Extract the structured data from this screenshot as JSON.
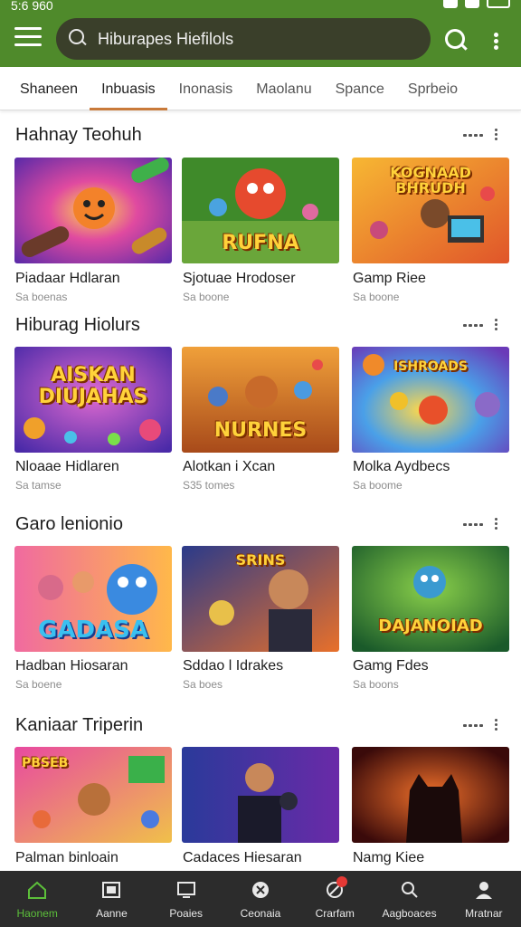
{
  "status": {
    "time": "5:6 960"
  },
  "search": {
    "placeholder": "Hiburapes Hiefilols"
  },
  "tabs": [
    "Shaneen",
    "Inbuasis",
    "Inonasis",
    "Maolanu",
    "Spance",
    "Sprbeio"
  ],
  "sections": [
    {
      "title": "Hahnay Teohuh",
      "cards": [
        {
          "title": "Piadaar Hdlaran",
          "sub": "Sa boenas",
          "thumb_text": ""
        },
        {
          "title": "Sjotuae Hrodoser",
          "sub": "Sa boone",
          "thumb_text": "RUFNA"
        },
        {
          "title": "Gamp Riee",
          "sub": "Sa boone",
          "thumb_text": "KOGNAAD BHRUDH"
        }
      ]
    },
    {
      "title": "Hiburag Hiolurs",
      "cards": [
        {
          "title": "Nloaae Hidlaren",
          "sub": "Sa tamse",
          "thumb_text": "AISKAN DIUJAHAS"
        },
        {
          "title": "Alotkan i Xcan",
          "sub": "S35 tomes",
          "thumb_text": "NURNES"
        },
        {
          "title": "Molka Aydbecs",
          "sub": "Sa boome",
          "thumb_text": "ISHROADS"
        }
      ]
    },
    {
      "title": "Garo lenionio",
      "cards": [
        {
          "title": "Hadban Hiosaran",
          "sub": "Sa boene",
          "thumb_text": "GADASA"
        },
        {
          "title": "Sddao l Idrakes",
          "sub": "Sa boes",
          "thumb_text": "SRINS"
        },
        {
          "title": "Gamg Fdes",
          "sub": "Sa boons",
          "thumb_text": "DAJANOIAD"
        }
      ]
    },
    {
      "title": "Kaniaar Triperin",
      "cards": [
        {
          "title": "Palman binloain",
          "sub": "",
          "thumb_text": "PBSEB"
        },
        {
          "title": "Cadaces Hiesaran",
          "sub": "",
          "thumb_text": ""
        },
        {
          "title": "Namg Kiee",
          "sub": "",
          "thumb_text": ""
        }
      ]
    }
  ],
  "bottom_nav": [
    {
      "label": "Haonem",
      "icon": "home-icon"
    },
    {
      "label": "Aanne",
      "icon": "gallery-icon"
    },
    {
      "label": "Poaies",
      "icon": "monitor-icon"
    },
    {
      "label": "Ceonaia",
      "icon": "compass-icon"
    },
    {
      "label": "Crarfam",
      "icon": "game-icon"
    },
    {
      "label": "Aagboaces",
      "icon": "search-icon"
    },
    {
      "label": "Mratnar",
      "icon": "profile-icon"
    }
  ],
  "colors": {
    "brand_green": "#4f8a2b",
    "tab_indicator": "#c97a3a",
    "nav_active": "#5cbf3a",
    "nav_bg": "#2c2c2c"
  }
}
